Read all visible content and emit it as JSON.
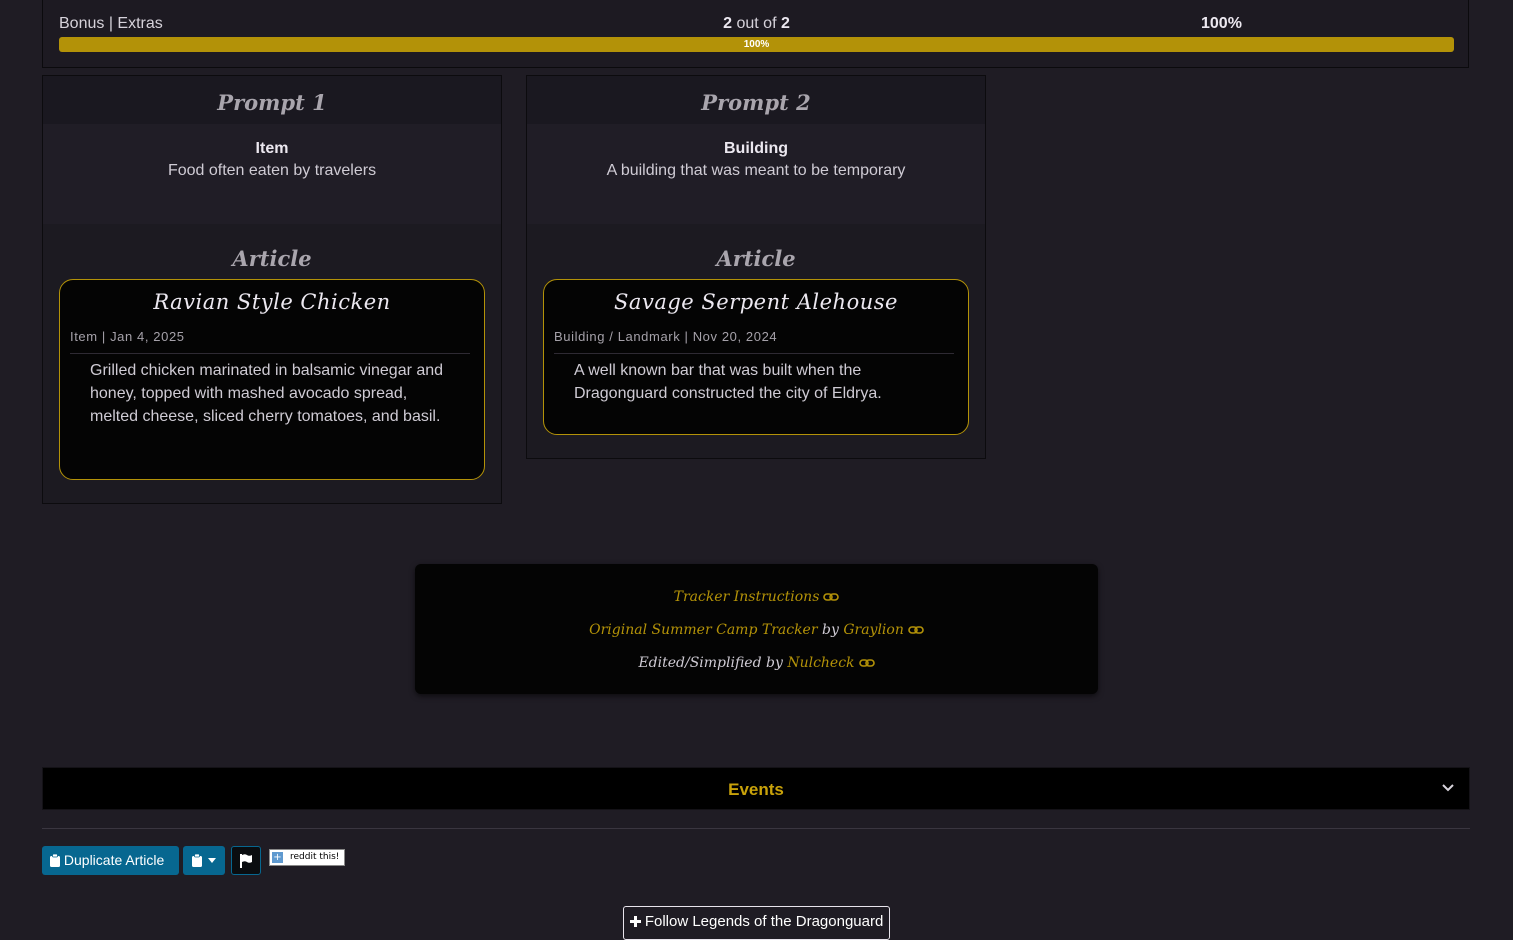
{
  "progress": {
    "label": "Bonus | Extras",
    "done": "2",
    "out_of": "out of",
    "total": "2",
    "percent_text": "100%",
    "bar_text": "100%",
    "fraction": 1.0,
    "bar_color": "#b39208"
  },
  "prompts": [
    {
      "title": "Prompt 1",
      "category": "Item",
      "description": "Food often eaten by travelers",
      "article_heading": "Article",
      "article": {
        "title": "Ravian Style Chicken",
        "meta": "Item | Jan 4, 2025",
        "summary": "Grilled chicken marinated in balsamic vinegar and honey, topped with mashed avocado spread, melted cheese, sliced cherry tomatoes, and basil."
      }
    },
    {
      "title": "Prompt 2",
      "category": "Building",
      "description": "A building that was meant to be temporary",
      "article_heading": "Article",
      "article": {
        "title": "Savage Serpent Alehouse",
        "meta": "Building / Landmark | Nov 20, 2024",
        "summary": "A well known bar that was built when the Dragonguard constructed the city of Eldrya."
      }
    }
  ],
  "credits": {
    "instructions_link": "Tracker Instructions",
    "original_link": "Original Summer Camp Tracker",
    "by_word": "by",
    "original_author": "Graylion",
    "edited_label": "Edited/Simplified by",
    "editor": "Nulcheck",
    "link_icon": "link-icon"
  },
  "events": {
    "title": "Events",
    "toggle_icon": "chevron-down-icon"
  },
  "actions": {
    "duplicate_label": "Duplicate Article",
    "clipboard_icon": "clipboard-icon",
    "dropdown_icon": "caret-down-icon",
    "flag_icon": "flag-icon",
    "reddit_label": "reddit this!"
  },
  "follow": {
    "label": "Follow Legends of the Dragonguard",
    "icon": "plus-icon"
  },
  "colors": {
    "accent_gold": "#b39208",
    "button_blue": "#076790",
    "background": "#1f1c24"
  }
}
